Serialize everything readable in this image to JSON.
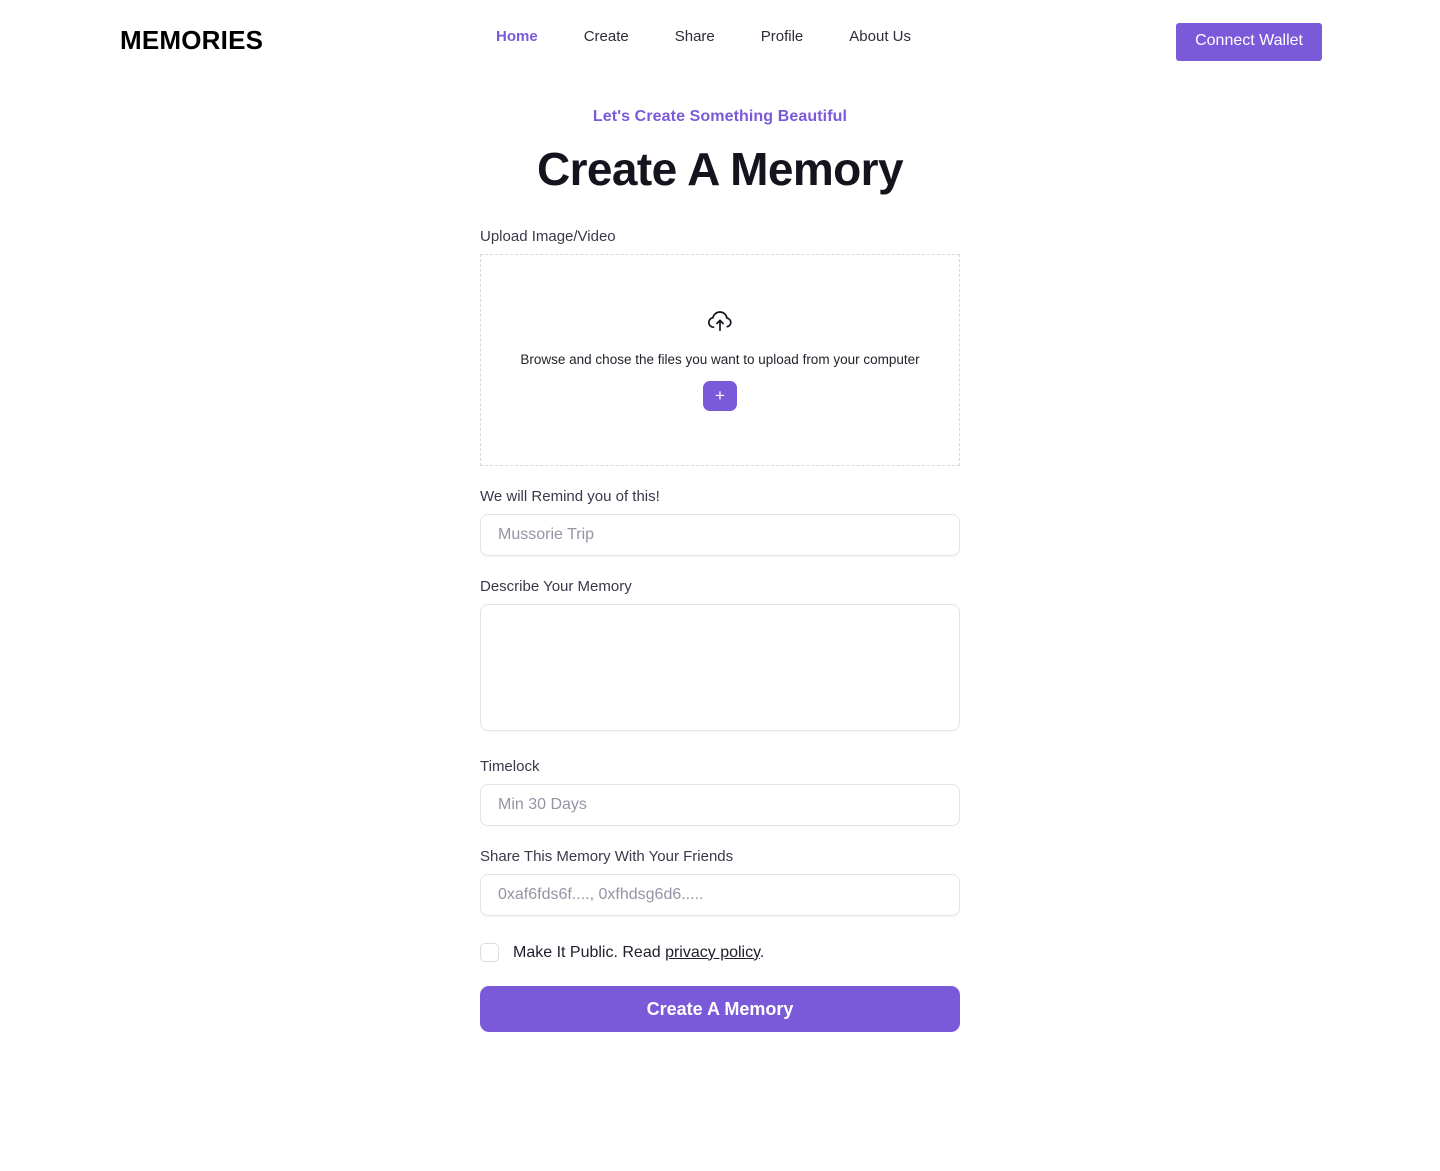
{
  "theme": {
    "accent": "#7b5ada",
    "heading": "#14141f",
    "body_text": "#2c2c38",
    "placeholder": "#9494a4",
    "border": "#e3e3ea",
    "dashed_border": "#d9d9e0",
    "background": "#ffffff"
  },
  "header": {
    "logo": "MEMORIES",
    "nav": [
      {
        "label": "Home",
        "active": true
      },
      {
        "label": "Create",
        "active": false
      },
      {
        "label": "Share",
        "active": false
      },
      {
        "label": "Profile",
        "active": false
      },
      {
        "label": "About Us",
        "active": false
      }
    ],
    "connect_wallet_label": "Connect Wallet"
  },
  "hero": {
    "eyebrow": "Let's Create Something Beautiful",
    "title": "Create A Memory"
  },
  "form": {
    "upload": {
      "label": "Upload Image/Video",
      "icon": "cloud-upload-icon",
      "hint": "Browse and chose the files you want to upload from your computer",
      "add_button_label": "+"
    },
    "title_field": {
      "label": "We will Remind you of this!",
      "placeholder": "Mussorie Trip",
      "value": ""
    },
    "description_field": {
      "label": "Describe Your Memory",
      "placeholder": "",
      "value": ""
    },
    "timelock_field": {
      "label": "Timelock",
      "placeholder": "Min 30 Days",
      "value": ""
    },
    "share_field": {
      "label": "Share This Memory With Your Friends",
      "placeholder": "0xaf6fds6f...., 0xfhdsg6d6.....",
      "value": ""
    },
    "public_checkbox": {
      "checked": false,
      "text_before": "Make It Public. Read ",
      "link_text": "privacy policy",
      "text_after": "."
    },
    "submit_label": "Create A Memory"
  }
}
